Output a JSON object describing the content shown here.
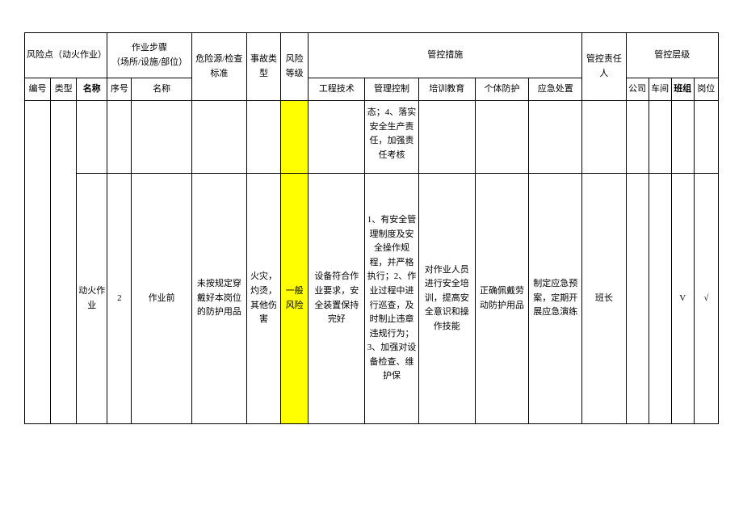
{
  "headers": {
    "risk_point": "风险点（动火作业）",
    "operation_steps": "作业步骤\n（场所/设施/部位）",
    "hazard_source": "危险源/检查标准",
    "accident_type": "事故类型",
    "risk_level": "风险等级",
    "control_measures": "管控措施",
    "responsible_person": "管控责任人",
    "control_level": "管控层级",
    "sub": {
      "no": "编号",
      "type": "类型",
      "name": "名称",
      "step_no": "序号",
      "step_name": "名称",
      "eng_tech": "工程技术",
      "manage_ctrl": "管理控制",
      "training": "培训教育",
      "ppe": "个体防护",
      "emergency": "应急处置",
      "company": "公司",
      "workshop": "车间",
      "team": "班组",
      "post": "岗位"
    }
  },
  "row_partial": {
    "manage_ctrl": "态；4、落实安全生产责任，加强责任考核"
  },
  "row_main": {
    "name": "动火作业",
    "step_no": "2",
    "step_name": "作业前",
    "hazard": "未按规定穿戴好本岗位的防护用品",
    "accident": "火灾，灼烫，其他伤害",
    "risk_level": "一般风险",
    "eng_tech": "设备符合作业要求，安全装置保持完好",
    "manage_ctrl": "1、有安全管理制度及安全操作规程，并严格执行；2、作业过程中进行巡查，及时制止违章违规行为；3、加强对设备检查、维护保",
    "training": "对作业人员进行安全培训，提高安全意识和操作技能",
    "ppe": "正确佩戴劳动防护用品",
    "emergency": "制定应急预案，定期开展应急演练",
    "responsible": "班长",
    "company": "",
    "workshop": "",
    "team": "V",
    "post": "√"
  }
}
